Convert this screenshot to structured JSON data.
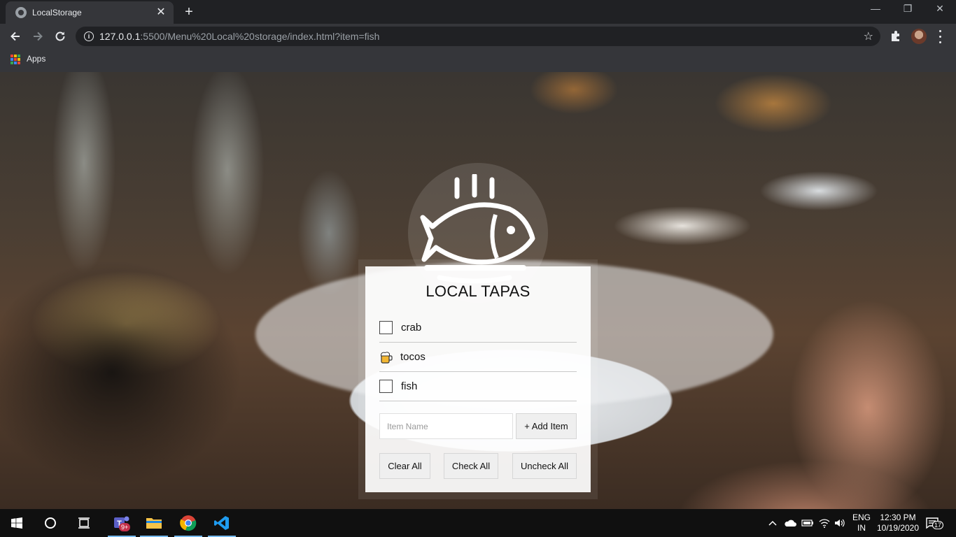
{
  "browser": {
    "tab_title": "LocalStorage",
    "tab_close": "✕",
    "new_tab": "+",
    "url_host": "127.0.0.1",
    "url_rest": ":5500/Menu%20Local%20storage/index.html?item=fish",
    "bookmark_apps": "Apps",
    "window_controls": {
      "minimize": "—",
      "restore": "❐",
      "close": "✕"
    }
  },
  "page": {
    "title": "LOCAL TAPAS",
    "items": [
      {
        "label": "crab",
        "checked": false
      },
      {
        "label": "tocos",
        "checked": true
      },
      {
        "label": "fish",
        "checked": false
      }
    ],
    "input_placeholder": "Item Name",
    "add_button": "+ Add Item",
    "clear_all": "Clear All",
    "check_all": "Check All",
    "uncheck_all": "Uncheck All"
  },
  "taskbar": {
    "teams_badge": "9+",
    "language": "ENG",
    "region": "IN",
    "time": "12:30 PM",
    "date": "10/19/2020",
    "notifications_count": "17"
  },
  "colors": {
    "chrome_dark": "#202124",
    "chrome_toolbar": "#35363a",
    "card_bg": "#ffffff",
    "taskbar_bg": "#101010",
    "accent_blue": "#76b9ed"
  }
}
